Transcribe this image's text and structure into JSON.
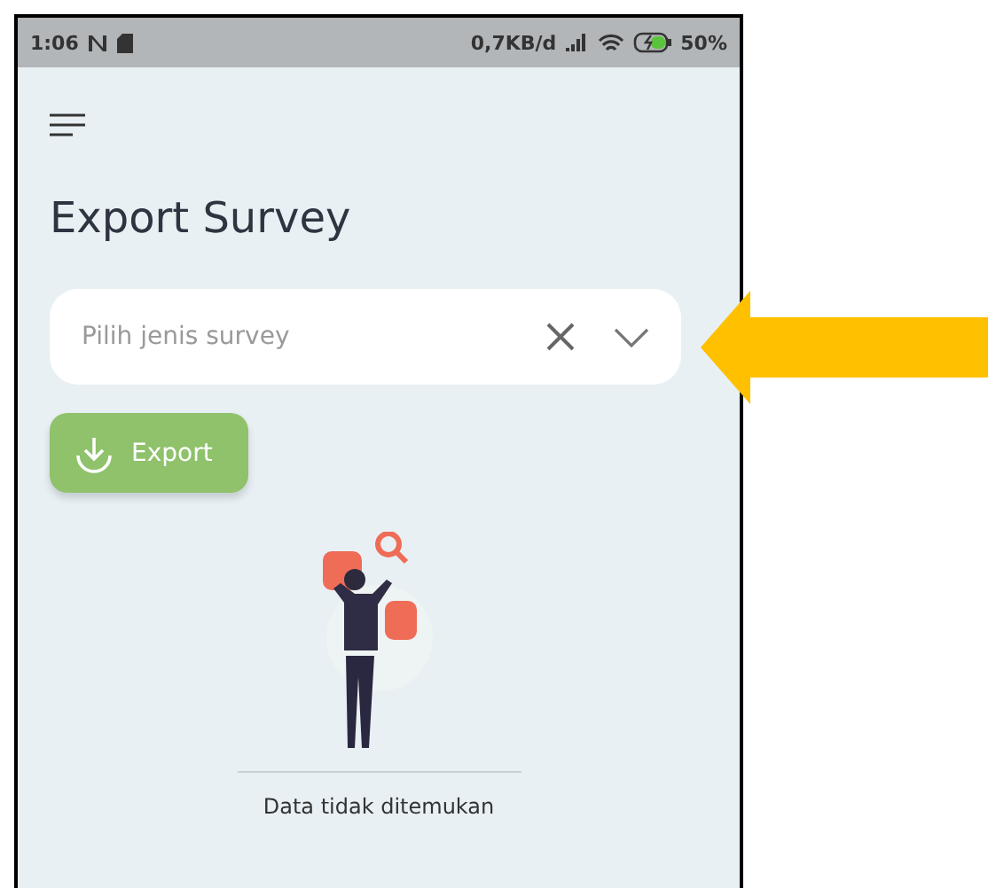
{
  "status_bar": {
    "time": "1:06",
    "network_speed": "0,7KB/d",
    "battery": "50%"
  },
  "page": {
    "title": "Export Survey"
  },
  "survey_select": {
    "placeholder": "Pilih jenis survey"
  },
  "export_button": {
    "label": "Export"
  },
  "empty_state": {
    "message": "Data tidak ditemukan"
  }
}
